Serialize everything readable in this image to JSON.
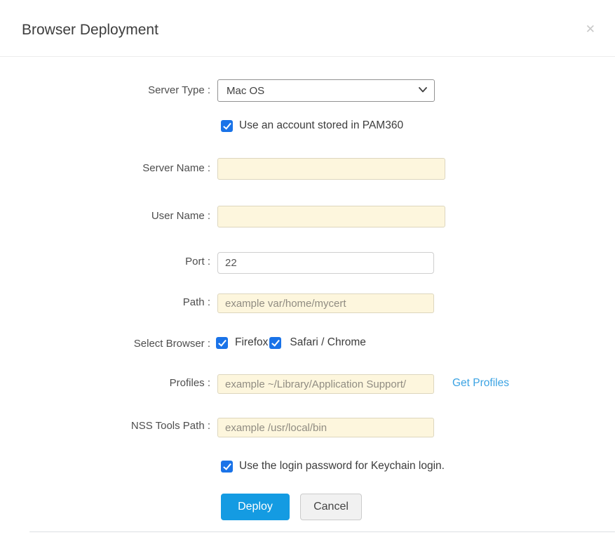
{
  "dialog": {
    "title": "Browser Deployment",
    "close_glyph": "✕"
  },
  "form": {
    "server_type": {
      "label": "Server Type :",
      "selected_value": "Mac OS"
    },
    "pam_account": {
      "label": "Use an account stored in PAM360",
      "checked": true
    },
    "server_name": {
      "label": "Server Name :",
      "value": "",
      "placeholder": ""
    },
    "user_name": {
      "label": "User Name :",
      "value": "",
      "placeholder": ""
    },
    "port": {
      "label": "Port :",
      "value": "22"
    },
    "path": {
      "label": "Path :",
      "placeholder": "example var/home/mycert"
    },
    "select_browser": {
      "label": "Select Browser :",
      "options": [
        {
          "label": "Firefox",
          "checked": true
        },
        {
          "label": "Safari / Chrome",
          "checked": true
        }
      ]
    },
    "profiles": {
      "label": "Profiles :",
      "placeholder": "example ~/Library/Application Support/",
      "link_label": "Get Profiles"
    },
    "nss_tools_path": {
      "label": "NSS Tools Path :",
      "placeholder": "example /usr/local/bin"
    },
    "keychain": {
      "label": "Use the login password for Keychain login.",
      "checked": true
    }
  },
  "buttons": {
    "deploy": "Deploy",
    "cancel": "Cancel"
  },
  "colors": {
    "accent_blue": "#149be2",
    "checkbox_blue": "#1a73e8",
    "link_blue": "#3ba3e3",
    "highlight_input_bg": "#fdf6dd"
  }
}
